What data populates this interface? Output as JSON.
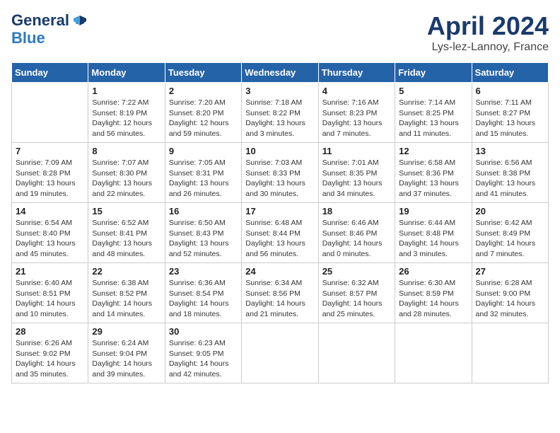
{
  "header": {
    "logo_line1": "General",
    "logo_line2": "Blue",
    "month_title": "April 2024",
    "location": "Lys-lez-Lannoy, France"
  },
  "days_of_week": [
    "Sunday",
    "Monday",
    "Tuesday",
    "Wednesday",
    "Thursday",
    "Friday",
    "Saturday"
  ],
  "weeks": [
    [
      {
        "day": "",
        "info": ""
      },
      {
        "day": "1",
        "info": "Sunrise: 7:22 AM\nSunset: 8:19 PM\nDaylight: 12 hours\nand 56 minutes."
      },
      {
        "day": "2",
        "info": "Sunrise: 7:20 AM\nSunset: 8:20 PM\nDaylight: 12 hours\nand 59 minutes."
      },
      {
        "day": "3",
        "info": "Sunrise: 7:18 AM\nSunset: 8:22 PM\nDaylight: 13 hours\nand 3 minutes."
      },
      {
        "day": "4",
        "info": "Sunrise: 7:16 AM\nSunset: 8:23 PM\nDaylight: 13 hours\nand 7 minutes."
      },
      {
        "day": "5",
        "info": "Sunrise: 7:14 AM\nSunset: 8:25 PM\nDaylight: 13 hours\nand 11 minutes."
      },
      {
        "day": "6",
        "info": "Sunrise: 7:11 AM\nSunset: 8:27 PM\nDaylight: 13 hours\nand 15 minutes."
      }
    ],
    [
      {
        "day": "7",
        "info": "Sunrise: 7:09 AM\nSunset: 8:28 PM\nDaylight: 13 hours\nand 19 minutes."
      },
      {
        "day": "8",
        "info": "Sunrise: 7:07 AM\nSunset: 8:30 PM\nDaylight: 13 hours\nand 22 minutes."
      },
      {
        "day": "9",
        "info": "Sunrise: 7:05 AM\nSunset: 8:31 PM\nDaylight: 13 hours\nand 26 minutes."
      },
      {
        "day": "10",
        "info": "Sunrise: 7:03 AM\nSunset: 8:33 PM\nDaylight: 13 hours\nand 30 minutes."
      },
      {
        "day": "11",
        "info": "Sunrise: 7:01 AM\nSunset: 8:35 PM\nDaylight: 13 hours\nand 34 minutes."
      },
      {
        "day": "12",
        "info": "Sunrise: 6:58 AM\nSunset: 8:36 PM\nDaylight: 13 hours\nand 37 minutes."
      },
      {
        "day": "13",
        "info": "Sunrise: 6:56 AM\nSunset: 8:38 PM\nDaylight: 13 hours\nand 41 minutes."
      }
    ],
    [
      {
        "day": "14",
        "info": "Sunrise: 6:54 AM\nSunset: 8:40 PM\nDaylight: 13 hours\nand 45 minutes."
      },
      {
        "day": "15",
        "info": "Sunrise: 6:52 AM\nSunset: 8:41 PM\nDaylight: 13 hours\nand 48 minutes."
      },
      {
        "day": "16",
        "info": "Sunrise: 6:50 AM\nSunset: 8:43 PM\nDaylight: 13 hours\nand 52 minutes."
      },
      {
        "day": "17",
        "info": "Sunrise: 6:48 AM\nSunset: 8:44 PM\nDaylight: 13 hours\nand 56 minutes."
      },
      {
        "day": "18",
        "info": "Sunrise: 6:46 AM\nSunset: 8:46 PM\nDaylight: 14 hours\nand 0 minutes."
      },
      {
        "day": "19",
        "info": "Sunrise: 6:44 AM\nSunset: 8:48 PM\nDaylight: 14 hours\nand 3 minutes."
      },
      {
        "day": "20",
        "info": "Sunrise: 6:42 AM\nSunset: 8:49 PM\nDaylight: 14 hours\nand 7 minutes."
      }
    ],
    [
      {
        "day": "21",
        "info": "Sunrise: 6:40 AM\nSunset: 8:51 PM\nDaylight: 14 hours\nand 10 minutes."
      },
      {
        "day": "22",
        "info": "Sunrise: 6:38 AM\nSunset: 8:52 PM\nDaylight: 14 hours\nand 14 minutes."
      },
      {
        "day": "23",
        "info": "Sunrise: 6:36 AM\nSunset: 8:54 PM\nDaylight: 14 hours\nand 18 minutes."
      },
      {
        "day": "24",
        "info": "Sunrise: 6:34 AM\nSunset: 8:56 PM\nDaylight: 14 hours\nand 21 minutes."
      },
      {
        "day": "25",
        "info": "Sunrise: 6:32 AM\nSunset: 8:57 PM\nDaylight: 14 hours\nand 25 minutes."
      },
      {
        "day": "26",
        "info": "Sunrise: 6:30 AM\nSunset: 8:59 PM\nDaylight: 14 hours\nand 28 minutes."
      },
      {
        "day": "27",
        "info": "Sunrise: 6:28 AM\nSunset: 9:00 PM\nDaylight: 14 hours\nand 32 minutes."
      }
    ],
    [
      {
        "day": "28",
        "info": "Sunrise: 6:26 AM\nSunset: 9:02 PM\nDaylight: 14 hours\nand 35 minutes."
      },
      {
        "day": "29",
        "info": "Sunrise: 6:24 AM\nSunset: 9:04 PM\nDaylight: 14 hours\nand 39 minutes."
      },
      {
        "day": "30",
        "info": "Sunrise: 6:23 AM\nSunset: 9:05 PM\nDaylight: 14 hours\nand 42 minutes."
      },
      {
        "day": "",
        "info": ""
      },
      {
        "day": "",
        "info": ""
      },
      {
        "day": "",
        "info": ""
      },
      {
        "day": "",
        "info": ""
      }
    ]
  ]
}
